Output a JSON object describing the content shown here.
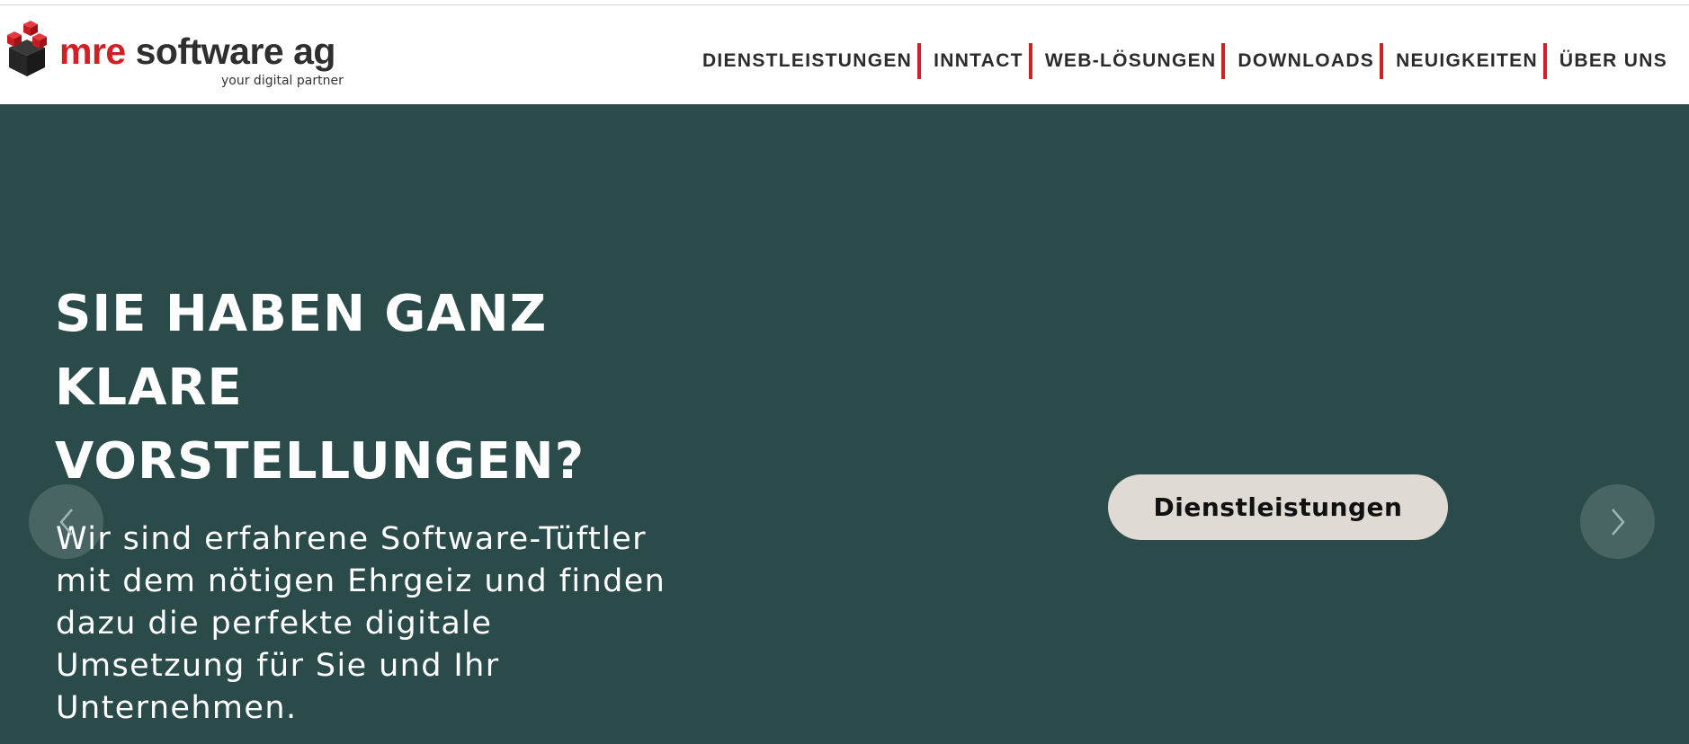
{
  "brand": {
    "name_accent": "mre",
    "name_rest": " software ag",
    "tagline": "your digital partner",
    "accent_color": "#d01f25"
  },
  "nav": {
    "items": [
      {
        "label": "DIENSTLEISTUNGEN"
      },
      {
        "label": "INNTACT"
      },
      {
        "label": "WEB-LÖSUNGEN"
      },
      {
        "label": "DOWNLOADS"
      },
      {
        "label": "NEUIGKEITEN"
      },
      {
        "label": "ÜBER UNS"
      }
    ]
  },
  "hero": {
    "background_color": "#2b4b4a",
    "title": "SIE HABEN GANZ KLARE VORSTELLUNGEN?",
    "text": "Wir sind erfahrene Software-Tüftler mit dem nötigen Ehrgeiz und finden dazu die perfekte digitale Umsetzung für Sie und Ihr Unternehmen.",
    "cta_label": "Dienstleistungen",
    "prev_icon": "chevron-left-icon",
    "next_icon": "chevron-right-icon"
  }
}
